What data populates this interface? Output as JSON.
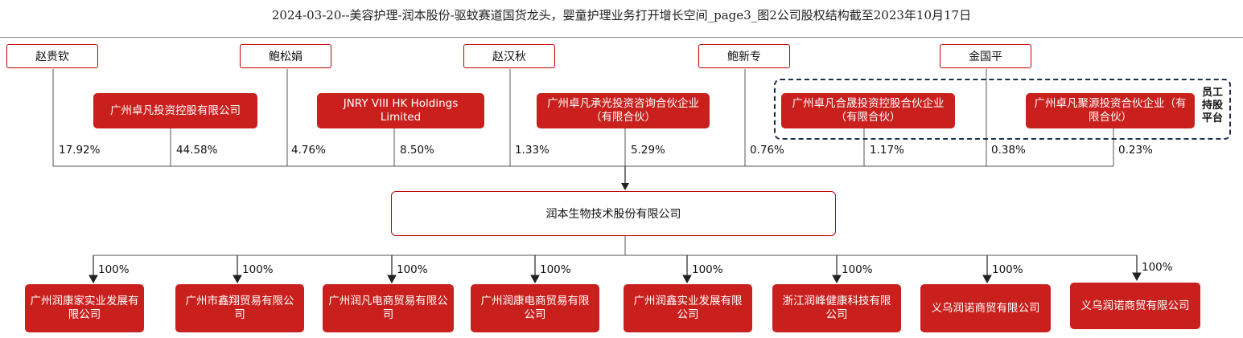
{
  "title": "2024-03-20--美容护理-润本股份-驱蚊赛道国货龙头，婴童护理业务打开增长空间_page3_图2公司股权结构截至2023年10月17日",
  "persons": [
    "赵贵钦",
    "鲍松娟",
    "赵汉秋",
    "鲍新专",
    "金国平"
  ],
  "holding_entities": [
    "广州卓凡投资控股有限公司",
    "JNRY VIII HK Holdings Limited",
    "广州卓凡承光投资咨询合伙企业（有限合伙）",
    "广州卓凡合晟投资控股合伙企业（有限合伙）",
    "广州卓凡聚源投资合伙企业（有限合伙）"
  ],
  "employee_platform_label": "员工持股平台",
  "shareholdings": [
    "17.92%",
    "44.58%",
    "4.76%",
    "8.50%",
    "1.33%",
    "5.29%",
    "0.76%",
    "1.17%",
    "0.38%",
    "0.23%"
  ],
  "company": "润本生物技术股份有限公司",
  "subsidiaries": [
    {
      "name": "广州润康家实业发展有限公司",
      "pct": "100%"
    },
    {
      "name": "广州市鑫翔贸易有限公司",
      "pct": "100%"
    },
    {
      "name": "广州润凡电商贸易有限公司",
      "pct": "100%"
    },
    {
      "name": "广州润康电商贸易有限公司",
      "pct": "100%"
    },
    {
      "name": "广州润鑫实业发展有限公司",
      "pct": "100%"
    },
    {
      "name": "浙江润峰健康科技有限公司",
      "pct": "100%"
    },
    {
      "name": "义乌润诺商贸有限公司",
      "pct": "100%"
    },
    {
      "name": "义乌润诺商贸有限公司",
      "pct": "100%"
    }
  ]
}
